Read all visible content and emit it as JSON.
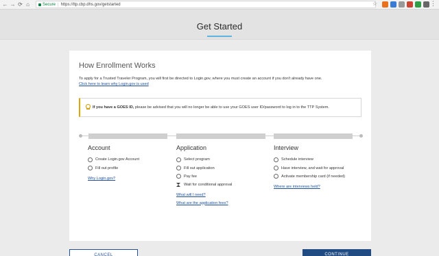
{
  "browser": {
    "secure_label": "Secure",
    "url": "https://ttp.cbp.dhs.gov/getstarted",
    "back_icon": "←",
    "forward_icon": "→",
    "reload_icon": "⟳",
    "home_icon": "⌂",
    "star_icon": "☆",
    "menu_icon": "⋮"
  },
  "header": {
    "title": "Get Started",
    "accent_color": "#5cb4e0"
  },
  "main": {
    "heading": "How Enrollment Works",
    "intro": "To apply for a Trusted Traveler Program, you will first be directed to Login.gov, where you must create an account if you don't already have one.",
    "intro_link": "Click here to learn why Login.gov is used",
    "alert_bold": "If you have a GOES ID,",
    "alert_rest": " please be advised that you will no longer be able to use your GOES user ID/password to log in to the TTP System."
  },
  "columns": [
    {
      "title": "Account",
      "steps": [
        "Create Login.gov Account",
        "Fill out profile"
      ],
      "links": [
        "Why Login.gov?"
      ]
    },
    {
      "title": "Application",
      "steps": [
        "Select program",
        "Fill out application",
        "Pay fee",
        "Wait for conditional approval"
      ],
      "links": [
        "What will I need?",
        "What are the application fees?"
      ]
    },
    {
      "title": "Interview",
      "steps": [
        "Schedule interview",
        "Have interview, and wait for approval",
        "Activate membership card (if needed)"
      ],
      "links": [
        "Where are interviews held?"
      ]
    }
  ],
  "buttons": {
    "cancel": "CANCEL",
    "continue": "CONTINUE",
    "primary_color": "#204b82"
  }
}
